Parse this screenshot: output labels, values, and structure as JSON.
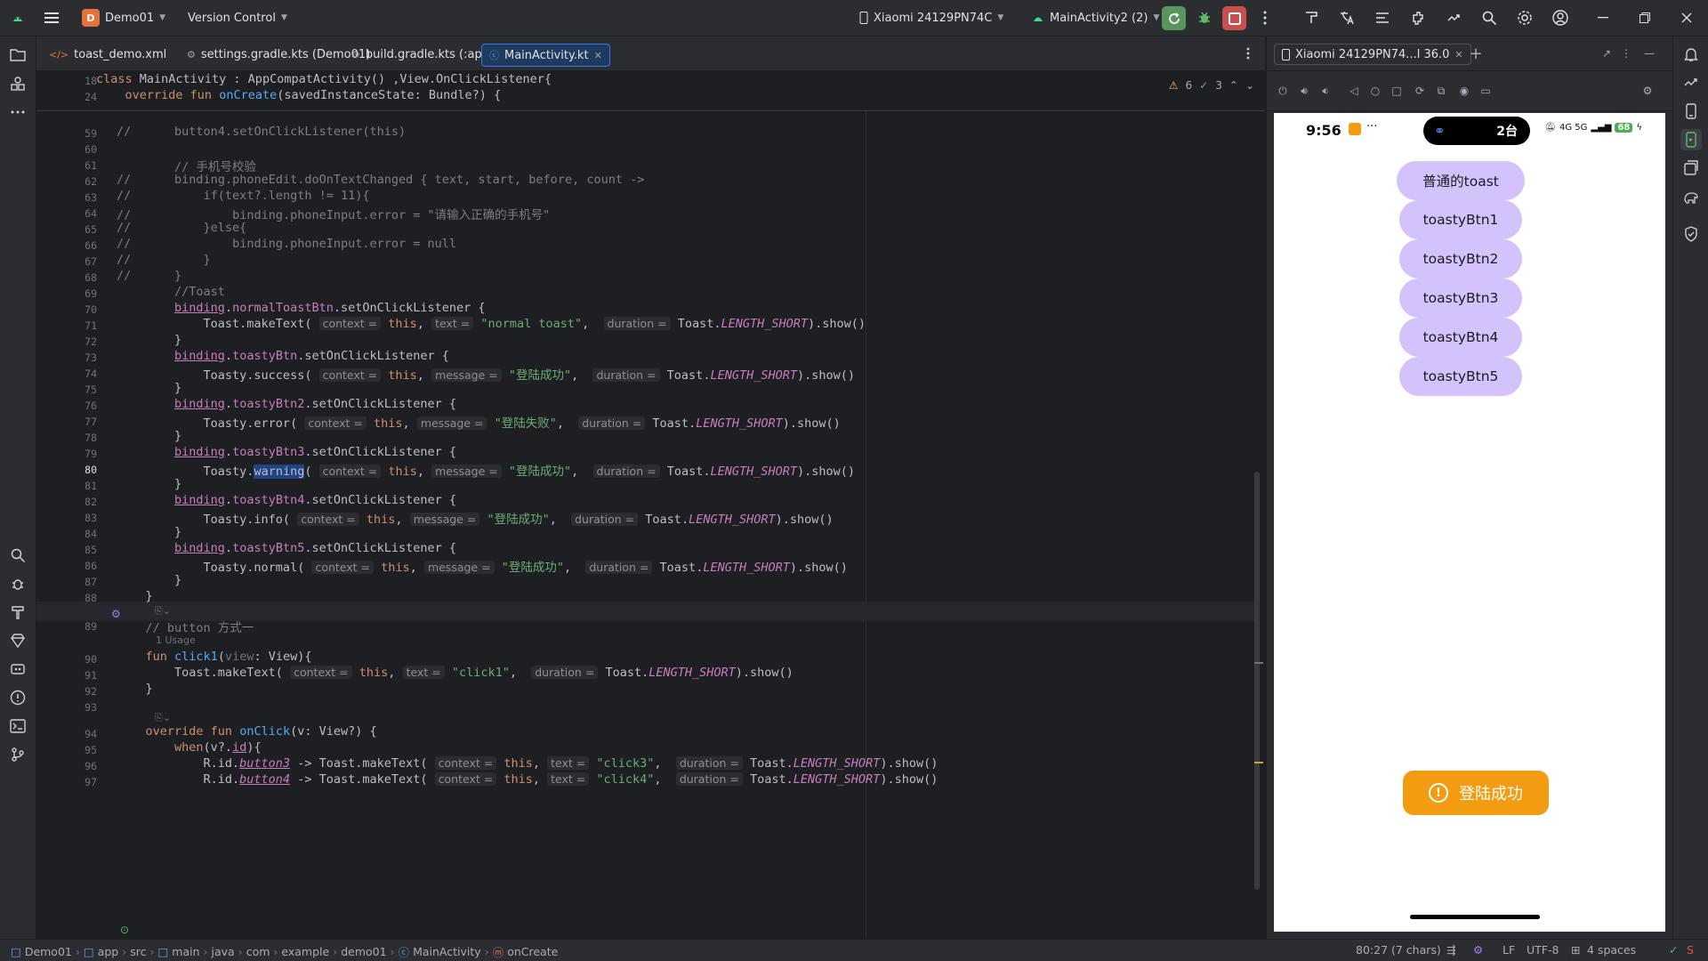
{
  "titlebar": {
    "project_initial": "D",
    "project_name": "Demo01",
    "vcs": "Version Control",
    "device": "Xiaomi 24129PN74C",
    "run_config": "MainActivity2 (2)"
  },
  "tabs": [
    {
      "label": "toast_demo.xml"
    },
    {
      "label": "settings.gradle.kts (Demo01)"
    },
    {
      "label": "build.gradle.kts (:app)"
    },
    {
      "label": "MainActivity.kt"
    }
  ],
  "editor": {
    "warnings": "6",
    "checks": "3",
    "sticky": [
      {
        "ln": "18"
      },
      {
        "ln": "24"
      }
    ],
    "lines": [
      {
        "ln": "59"
      },
      {
        "ln": "60"
      },
      {
        "ln": "61"
      },
      {
        "ln": "62"
      },
      {
        "ln": "63"
      },
      {
        "ln": "64"
      },
      {
        "ln": "65"
      },
      {
        "ln": "66"
      },
      {
        "ln": "67"
      },
      {
        "ln": "68"
      },
      {
        "ln": "69"
      },
      {
        "ln": "70"
      },
      {
        "ln": "71"
      },
      {
        "ln": "72"
      },
      {
        "ln": "73"
      },
      {
        "ln": "74"
      },
      {
        "ln": "75"
      },
      {
        "ln": "76"
      },
      {
        "ln": "77"
      },
      {
        "ln": "78"
      },
      {
        "ln": "79"
      },
      {
        "ln": "80"
      },
      {
        "ln": "81"
      },
      {
        "ln": "82"
      },
      {
        "ln": "83"
      },
      {
        "ln": "84"
      },
      {
        "ln": "85"
      },
      {
        "ln": "86"
      },
      {
        "ln": "87"
      },
      {
        "ln": "88"
      },
      {
        "ln": "89"
      },
      {
        "ln": "90"
      },
      {
        "ln": "91"
      },
      {
        "ln": "92"
      },
      {
        "ln": "93"
      },
      {
        "ln": "94"
      },
      {
        "ln": "95"
      },
      {
        "ln": "96"
      },
      {
        "ln": "97"
      }
    ],
    "usage_hint": "1 Usage",
    "strings": {
      "context": "context =",
      "text": "text =",
      "message": "message =",
      "duration": "duration =",
      "s_button4": "button4.setOnClickListener(this)",
      "c_phone": "// 手机号校验",
      "s_phone_edit": "binding.phoneEdit.doOnTextChanged { text, start, before, count ->",
      "s_if": "if(text?.length != 11){",
      "s_error_set": "binding.phoneInput.error = \"请输入正确的手机号\"",
      "s_else": "}else{",
      "s_error_null": "binding.phoneInput.error = null",
      "s_close": "}",
      "c_toast": "//Toast",
      "c_button": "// button 方式一",
      "str_normal": "\"normal toast\"",
      "str_success": "\"登陆成功\"",
      "str_fail": "\"登陆失败\"",
      "str_click1": "\"click1\"",
      "str_click3": "\"click3\"",
      "str_click4": "\"click4\""
    }
  },
  "device_panel": {
    "tab_label": "Xiaomi 24129PN74...l 36.0",
    "status_time": "9:56",
    "pill_count": "2台",
    "signal_text": "4G 5G",
    "battery": "68",
    "buttons": [
      {
        "label": "普通的toast"
      },
      {
        "label": "toastyBtn1"
      },
      {
        "label": "toastyBtn2"
      },
      {
        "label": "toastyBtn3"
      },
      {
        "label": "toastyBtn4"
      },
      {
        "label": "toastyBtn5"
      }
    ],
    "toast_text": "登陆成功",
    "button_color": "#d3c2fb",
    "toast_color": "#f39c12"
  },
  "status": {
    "breadcrumbs": [
      "Demo01",
      "app",
      "src",
      "main",
      "java",
      "com",
      "example",
      "demo01",
      "MainActivity",
      "onCreate"
    ],
    "position": "80:27 (7 chars)",
    "line_sep": "LF",
    "encoding": "UTF-8",
    "indent": "4 spaces"
  }
}
